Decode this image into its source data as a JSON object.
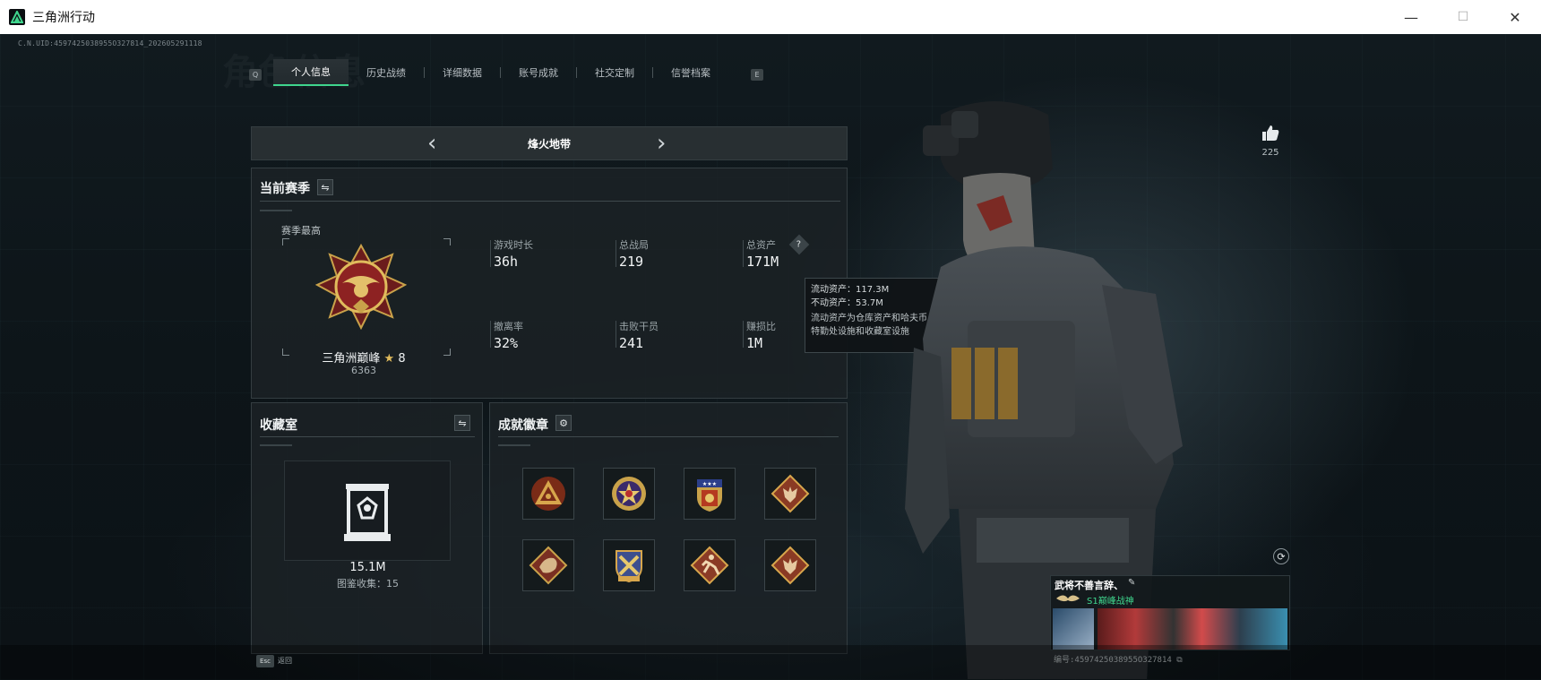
{
  "window": {
    "title": "三角洲行动",
    "minimize": "—",
    "maximize": "☐",
    "close": "✕"
  },
  "uid_text": "C.N.UID:4597425038955O327814_202605291118",
  "ghost_title": "角色信息",
  "tabs": {
    "left_key": "Q",
    "right_key": "E",
    "items": [
      {
        "label": "个人信息",
        "active": true
      },
      {
        "label": "历史战绩"
      },
      {
        "label": "详细数据"
      },
      {
        "label": "账号成就"
      },
      {
        "label": "社交定制"
      },
      {
        "label": "信誉档案"
      }
    ]
  },
  "region": {
    "name": "烽火地带",
    "prev": "‹",
    "next": "›"
  },
  "season": {
    "title": "当前赛季",
    "swap_icon": "⇋",
    "best_label": "赛季最高",
    "rank_name": "三角洲巅峰",
    "rank_stars": "8",
    "rank_points": "6363",
    "stats": [
      {
        "label": "游戏时长",
        "value": "36h"
      },
      {
        "label": "总战局",
        "value": "219"
      },
      {
        "label": "总资产",
        "value": "171M"
      },
      {
        "label": "撤离率",
        "value": "32%"
      },
      {
        "label": "击败干员",
        "value": "241"
      },
      {
        "label": "赚损比",
        "value": "1M"
      }
    ],
    "help_icon": "?"
  },
  "tooltip": {
    "line1": "流动资产：117.3M",
    "line2": "不动资产：53.7M",
    "line3": "流动资产为仓库资产和哈夫币，不动资产为特勤处设施和收藏室设施"
  },
  "collection": {
    "title": "收藏室",
    "swap_icon": "⇋",
    "value": "15.1M",
    "progress_label": "图鉴收集：",
    "progress_value": "15"
  },
  "achievements": {
    "title": "成就徽章",
    "gear_icon": "⚙",
    "badges": [
      {
        "icon": "triangle-eye-badge-icon"
      },
      {
        "icon": "star-cross-badge-icon"
      },
      {
        "icon": "shield-stars-badge-icon"
      },
      {
        "icon": "wolf-diamond-badge-icon"
      },
      {
        "icon": "dragon-diamond-badge-icon"
      },
      {
        "icon": "crossed-guns-badge-icon"
      },
      {
        "icon": "runner-diamond-badge-icon"
      },
      {
        "icon": "wolf-diamond-badge-icon"
      }
    ]
  },
  "profile": {
    "likes": "225",
    "name": "武将不善言辞、",
    "edit_icon": "✎",
    "rank_title": "S1巅峰战神",
    "id_text": "编号:4597425038955O327814",
    "copy_icon": "⧉",
    "refresh_icon": "⟳"
  },
  "footer": {
    "esc_key": "Esc",
    "back_label": "返回"
  },
  "colors": {
    "accent": "#3fd58d",
    "gold": "#c9a24a",
    "panel": "#1c2226"
  }
}
